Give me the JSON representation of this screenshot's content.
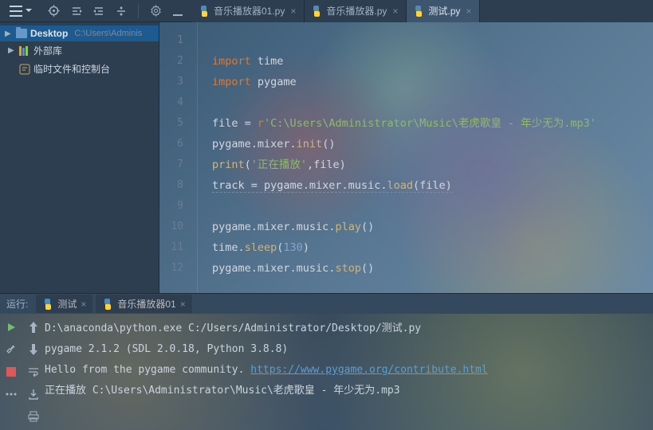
{
  "toolbar": {
    "menu_label": "",
    "icons": [
      "target",
      "indent-left",
      "indent-right",
      "refresh",
      "gear"
    ]
  },
  "tabs": [
    {
      "label": "音乐播放器01.py",
      "active": false
    },
    {
      "label": "音乐播放器.py",
      "active": false
    },
    {
      "label": "测试.py",
      "active": true
    }
  ],
  "sidebar": {
    "items": [
      {
        "kind": "project",
        "label": "Desktop",
        "path": "C:\\Users\\Adminis",
        "expanded": true
      },
      {
        "kind": "libs",
        "label": "外部库",
        "expanded": true
      },
      {
        "kind": "scratch",
        "label": "临时文件和控制台"
      }
    ]
  },
  "editor": {
    "lines": [
      {
        "n": 1,
        "segs": []
      },
      {
        "n": 2,
        "segs": [
          [
            "kw",
            "import"
          ],
          [
            "plain",
            " time"
          ]
        ]
      },
      {
        "n": 3,
        "segs": [
          [
            "kw",
            "import"
          ],
          [
            "plain",
            " pygame"
          ]
        ]
      },
      {
        "n": 4,
        "segs": []
      },
      {
        "n": 5,
        "segs": [
          [
            "plain",
            "file = "
          ],
          [
            "kw",
            "r"
          ],
          [
            "str",
            "'C:\\Users\\Administrator\\Music\\老虎歌皇 - 年少无为.mp3'"
          ]
        ]
      },
      {
        "n": 6,
        "segs": [
          [
            "plain",
            "pygame.mixer."
          ],
          [
            "fn",
            "init"
          ],
          [
            "plain",
            "()"
          ]
        ]
      },
      {
        "n": 7,
        "segs": [
          [
            "fn",
            "print"
          ],
          [
            "plain",
            "("
          ],
          [
            "str",
            "'正在播放'"
          ],
          [
            "plain",
            ",file)"
          ]
        ]
      },
      {
        "n": 8,
        "segs": [
          [
            "plain",
            "track = pygame.mixer.music."
          ],
          [
            "fn",
            "load"
          ],
          [
            "plain",
            "(file)"
          ]
        ],
        "wavy": true
      },
      {
        "n": 9,
        "segs": []
      },
      {
        "n": 10,
        "segs": [
          [
            "plain",
            "pygame.mixer.music."
          ],
          [
            "fn",
            "play"
          ],
          [
            "plain",
            "()"
          ]
        ]
      },
      {
        "n": 11,
        "segs": [
          [
            "plain",
            "time."
          ],
          [
            "fn",
            "sleep"
          ],
          [
            "plain",
            "("
          ],
          [
            "num",
            "130"
          ],
          [
            "plain",
            ")"
          ]
        ]
      },
      {
        "n": 12,
        "segs": [
          [
            "plain",
            "pygame.mixer.music."
          ],
          [
            "fn",
            "stop"
          ],
          [
            "plain",
            "()"
          ]
        ]
      }
    ]
  },
  "run": {
    "label": "运行:",
    "tabs": [
      {
        "label": "测试"
      },
      {
        "label": "音乐播放器01"
      }
    ],
    "output": [
      {
        "text": "D:\\anaconda\\python.exe C:/Users/Administrator/Desktop/测试.py"
      },
      {
        "text": "pygame 2.1.2 (SDL 2.0.18, Python 3.8.8)"
      },
      {
        "text": "Hello from the pygame community. ",
        "link": "https://www.pygame.org/contribute.html"
      },
      {
        "text": "正在播放 C:\\Users\\Administrator\\Music\\老虎歌皇 - 年少无为.mp3"
      }
    ],
    "left_icons_col1": [
      "play-green",
      "stop-red",
      "more"
    ],
    "left_icons_col2": [
      "arrow-up",
      "arrow-down",
      "wrap",
      "download",
      "print"
    ]
  }
}
